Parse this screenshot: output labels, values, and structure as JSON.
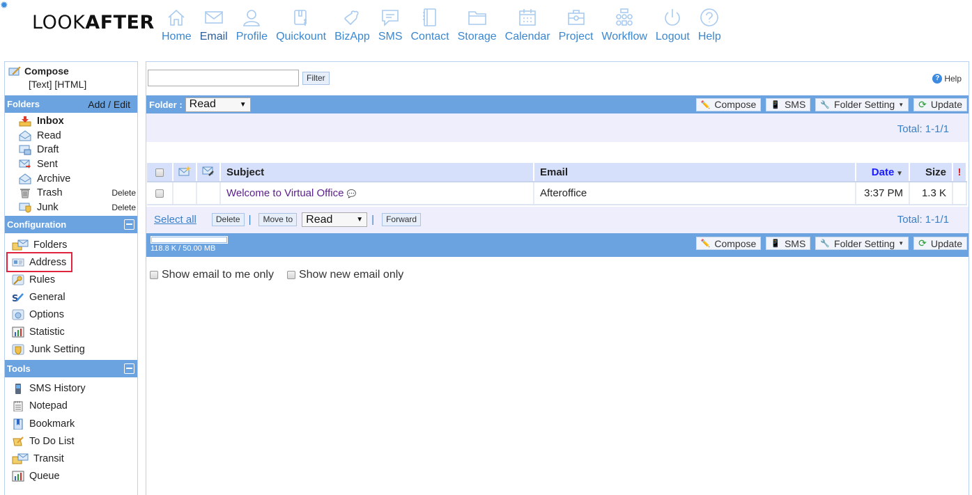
{
  "app": {
    "logo_light": "LOOK",
    "logo_bold": "AFTER"
  },
  "topnav": [
    {
      "label": "Home",
      "icon": "home-icon"
    },
    {
      "label": "Email",
      "icon": "email-icon",
      "active": true
    },
    {
      "label": "Profile",
      "icon": "profile-icon"
    },
    {
      "label": "Quickount",
      "icon": "quickount-icon"
    },
    {
      "label": "BizApp",
      "icon": "bizapp-icon"
    },
    {
      "label": "SMS",
      "icon": "sms-icon"
    },
    {
      "label": "Contact",
      "icon": "contact-icon"
    },
    {
      "label": "Storage",
      "icon": "storage-icon"
    },
    {
      "label": "Calendar",
      "icon": "calendar-icon"
    },
    {
      "label": "Project",
      "icon": "project-icon"
    },
    {
      "label": "Workflow",
      "icon": "workflow-icon"
    },
    {
      "label": "Logout",
      "icon": "logout-icon"
    },
    {
      "label": "Help",
      "icon": "help-icon"
    }
  ],
  "sidebar": {
    "compose": {
      "title": "Compose",
      "text": "[Text]",
      "html": "[HTML]"
    },
    "folders_header": {
      "title": "Folders",
      "action": "Add / Edit"
    },
    "folders": [
      {
        "label": "Inbox",
        "bold": true
      },
      {
        "label": "Read"
      },
      {
        "label": "Draft"
      },
      {
        "label": "Sent"
      },
      {
        "label": "Archive"
      },
      {
        "label": "Trash",
        "action": "Delete"
      },
      {
        "label": "Junk",
        "action": "Delete"
      }
    ],
    "config_header": {
      "title": "Configuration"
    },
    "config": [
      {
        "label": "Folders"
      },
      {
        "label": "Address",
        "highlighted": true
      },
      {
        "label": "Rules"
      },
      {
        "label": "General"
      },
      {
        "label": "Options"
      },
      {
        "label": "Statistic"
      },
      {
        "label": "Junk Setting"
      }
    ],
    "tools_header": {
      "title": "Tools"
    },
    "tools": [
      {
        "label": "SMS History"
      },
      {
        "label": "Notepad"
      },
      {
        "label": "Bookmark"
      },
      {
        "label": "To Do List"
      },
      {
        "label": "Transit"
      },
      {
        "label": "Queue"
      }
    ]
  },
  "main": {
    "filter": {
      "value": "",
      "button": "Filter"
    },
    "help": "Help",
    "folder_label": "Folder :",
    "folder_selected": "Read",
    "toolbar": {
      "compose": "Compose",
      "sms": "SMS",
      "folder_setting": "Folder Setting",
      "update": "Update"
    },
    "total": "Total: 1-1/1",
    "table": {
      "headers": {
        "subject": "Subject",
        "email": "Email",
        "date": "Date",
        "size": "Size",
        "priority": "!"
      },
      "rows": [
        {
          "subject": "Welcome to Virtual Office",
          "email": "Afteroffice",
          "date": "3:37 PM",
          "size": "1.3 K"
        }
      ]
    },
    "actions": {
      "select_all": "Select all",
      "delete": "Delete",
      "move_to": "Move to",
      "move_target": "Read",
      "forward": "Forward",
      "separator": "|"
    },
    "quota": {
      "text": "118.8 K / 50.00 MB",
      "used_percent": 0.23
    },
    "options": [
      {
        "label": "Show email to me only",
        "checked": false
      },
      {
        "label": "Show new email only",
        "checked": false
      }
    ]
  },
  "colors": {
    "accent": "#6aa3e0",
    "link": "#3a80c8",
    "band": "#eeeefc",
    "highlight": "#e0233f",
    "visited_subject": "#5a1f8a"
  }
}
